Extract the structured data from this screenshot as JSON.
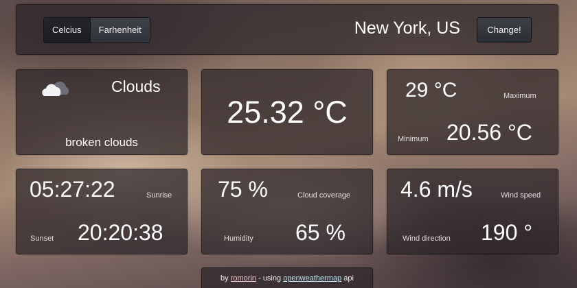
{
  "units": {
    "celsius_label": "Celcius",
    "fahrenheit_label": "Farhenheit"
  },
  "location": {
    "city": "New York, US",
    "change_label": "Change!"
  },
  "condition": {
    "icon": "clouds-icon",
    "main": "Clouds",
    "description": "broken clouds"
  },
  "temperature": {
    "current": "25.32 °C",
    "max_value": "29 °C",
    "max_label": "Maximum",
    "min_value": "20.56 °C",
    "min_label": "Minimum"
  },
  "sun": {
    "sunrise_value": "05:27:22",
    "sunrise_label": "Sunrise",
    "sunset_value": "20:20:38",
    "sunset_label": "Sunset"
  },
  "atmosphere": {
    "cloud_value": "75 %",
    "cloud_label": "Cloud coverage",
    "humidity_value": "65 %",
    "humidity_label": "Humidity"
  },
  "wind": {
    "speed_value": "4.6 m/s",
    "speed_label": "Wind speed",
    "direction_value": "190 °",
    "direction_label": "Wind direction"
  },
  "footer": {
    "by": "by",
    "author": "romorin",
    "using": "- using",
    "api_name": "openweathermap",
    "api": "api"
  }
}
